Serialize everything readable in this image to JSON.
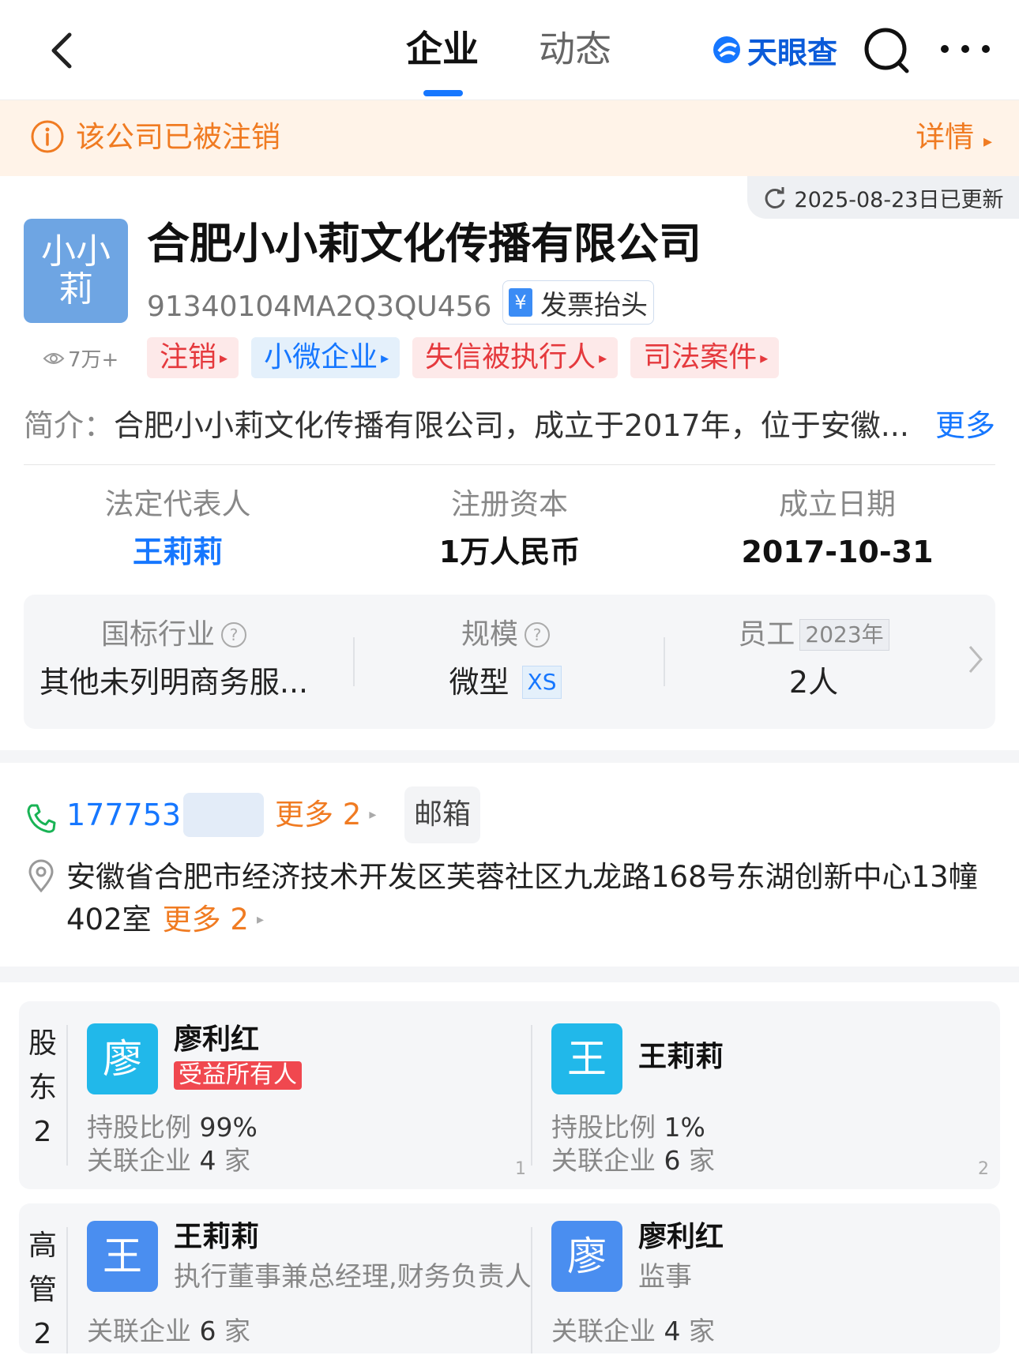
{
  "header": {
    "tabs": [
      {
        "label": "企业",
        "active": true
      },
      {
        "label": "动态",
        "active": false
      }
    ],
    "brand": "天眼查",
    "accent": "#1677ff"
  },
  "banner": {
    "text": "该公司已被注销",
    "detail": "详情",
    "color": "#f07b22"
  },
  "company": {
    "updated": "2025-08-23日已更新",
    "logo_lines": [
      "小小",
      "莉"
    ],
    "views": "7万+",
    "name": "合肥小小莉文化传播有限公司",
    "credit_code": "91340104MA2Q3QU456",
    "invoice_label": "发票抬头",
    "tags": [
      "注销",
      "小微企业",
      "失信被执行人",
      "司法案件"
    ],
    "intro_label": "简介：",
    "intro_text": "合肥小小莉文化传播有限公司，成立于2017年，位于安徽...",
    "intro_more": "更多",
    "legal_rep": {
      "label": "法定代表人",
      "value": "王莉莉"
    },
    "capital": {
      "label": "注册资本",
      "value": "1万人民币"
    },
    "founded": {
      "label": "成立日期",
      "value": "2017-10-31"
    },
    "industry": {
      "label": "国标行业",
      "value": "其他未列明商务服..."
    },
    "scale": {
      "label": "规模",
      "value": "微型",
      "badge": "XS"
    },
    "staff": {
      "label": "员工",
      "year": "2023年",
      "value": "2人"
    }
  },
  "contact": {
    "phone_visible": "1777537",
    "phone_more": "更多 2",
    "email_label": "邮箱",
    "address": "安徽省合肥市经济技术开发区芙蓉社区九龙路168号东湖创新中心13幢402室",
    "address_more": "更多 2"
  },
  "shareholders": {
    "label_chars": [
      "股",
      "东"
    ],
    "count": "2",
    "items": [
      {
        "avatar": "廖",
        "name": "廖利红",
        "badge": "受益所有人",
        "ratio_label": "持股比例",
        "ratio": "99%",
        "related_label": "关联企业",
        "related": "4",
        "unit": "家",
        "index": "1"
      },
      {
        "avatar": "王",
        "name": "王莉莉",
        "ratio_label": "持股比例",
        "ratio": "1%",
        "related_label": "关联企业",
        "related": "6",
        "unit": "家",
        "index": "2"
      }
    ]
  },
  "executives": {
    "label_chars": [
      "高",
      "管"
    ],
    "count": "2",
    "items": [
      {
        "avatar": "王",
        "name": "王莉莉",
        "role": "执行董事兼总经理,财务负责人",
        "related_label": "关联企业",
        "related": "6",
        "unit": "家"
      },
      {
        "avatar": "廖",
        "name": "廖利红",
        "role": "监事",
        "related_label": "关联企业",
        "related": "4",
        "unit": "家"
      }
    ]
  }
}
